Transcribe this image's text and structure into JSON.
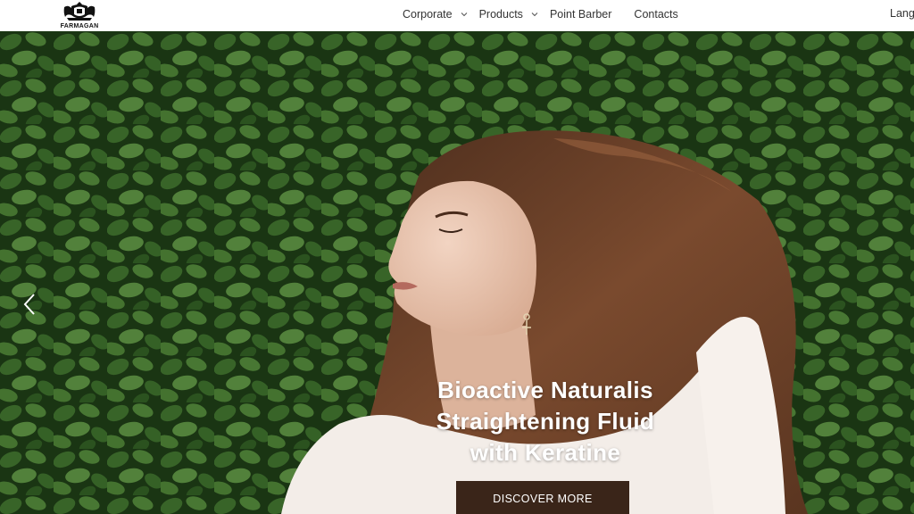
{
  "brand": {
    "logo_text": "FARMAGAN",
    "logo_icon": "crest-icon"
  },
  "nav": {
    "items": [
      {
        "label": "Corporate",
        "has_dropdown": true
      },
      {
        "label": "Products",
        "has_dropdown": true
      },
      {
        "label": "Point Barber",
        "has_dropdown": false
      },
      {
        "label": "Contacts",
        "has_dropdown": false
      }
    ],
    "language_label": "Language"
  },
  "hero": {
    "title_lines": [
      "Bioactive Naturalis",
      "Straightening Fluid",
      "with Keratine"
    ],
    "cta_label": "DISCOVER MORE",
    "prev_icon": "chevron-left-icon"
  },
  "colors": {
    "header_bg": "#ffffff",
    "nav_text": "#333333",
    "cta_bg": "#3a2519",
    "foliage": "#2f5a22",
    "hair": "#6b4028"
  }
}
